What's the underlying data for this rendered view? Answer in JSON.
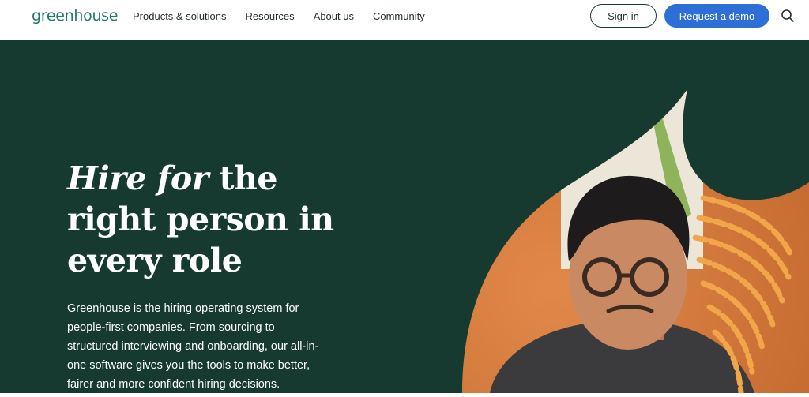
{
  "header": {
    "logo_text": "greenhouse",
    "nav": [
      "Products & solutions",
      "Resources",
      "About us",
      "Community"
    ],
    "signin_label": "Sign in",
    "demo_label": "Request a demo",
    "search_icon": "search-icon"
  },
  "hero": {
    "headline_italic": "Hire for",
    "headline_rest": " the right person in every role",
    "body": "Greenhouse is the hiring operating system for people-first companies. From sourcing to structured interviewing and onboarding, our all-in-one software gives you the tools to make better, fairer and more confident hiring decisions."
  },
  "colors": {
    "brand": "#1f7a6a",
    "hero_bg": "#163a30",
    "accent_blue": "#2d6fd6",
    "accent_orange": "#f2a64a"
  }
}
